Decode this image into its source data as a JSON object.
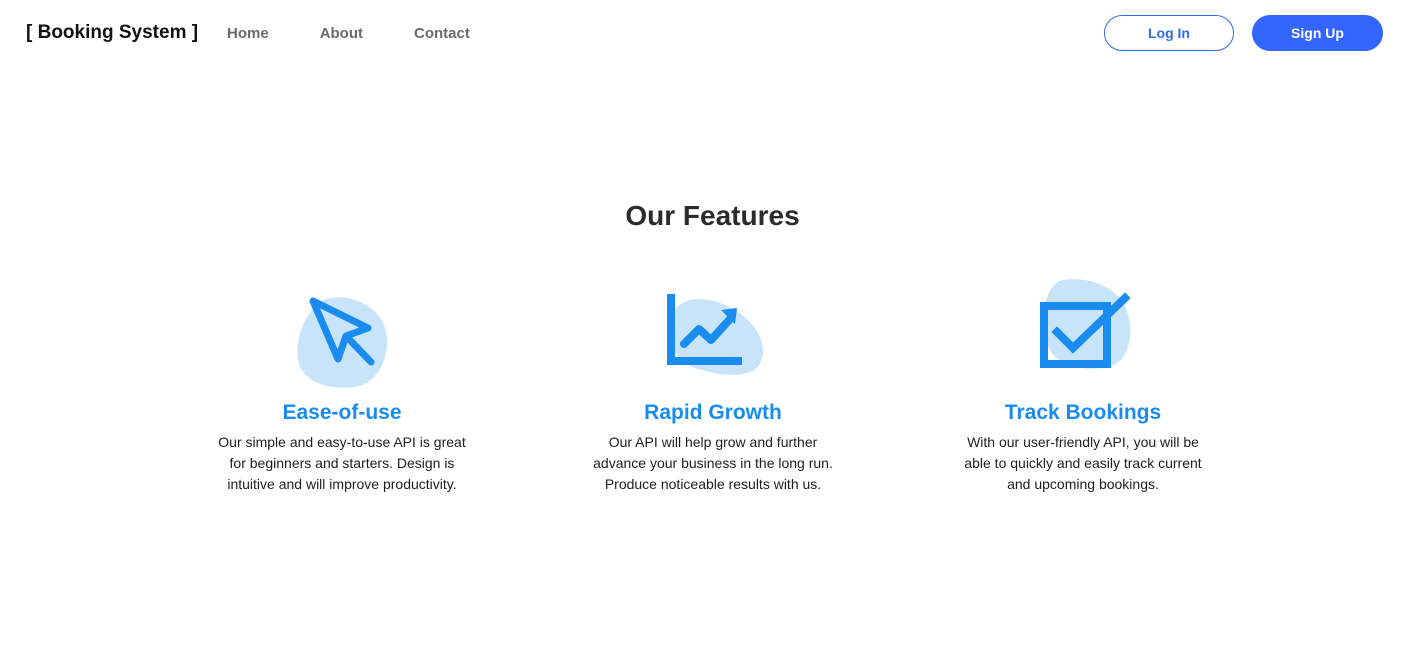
{
  "nav": {
    "brand": "[ Booking System ]",
    "links": [
      "Home",
      "About",
      "Contact"
    ],
    "login_label": "Log In",
    "signup_label": "Sign Up"
  },
  "features_section": {
    "title": "Our Features",
    "items": [
      {
        "icon": "cursor-arrow-icon",
        "title": "Ease-of-use",
        "description": "Our simple and easy-to-use API is great for beginners and starters. Design is intuitive and will improve productivity."
      },
      {
        "icon": "growth-chart-icon",
        "title": "Rapid Growth",
        "description": "Our API will help grow and further advance your business in the long run. Produce noticeable results with us."
      },
      {
        "icon": "checkbox-check-icon",
        "title": "Track Bookings",
        "description": "With our user-friendly API, you will be able to quickly and easily track current and upcoming bookings."
      }
    ]
  },
  "colors": {
    "accent": "#1a8cf0",
    "primary_button": "#3366ff",
    "blob": "#c7e4fb"
  }
}
